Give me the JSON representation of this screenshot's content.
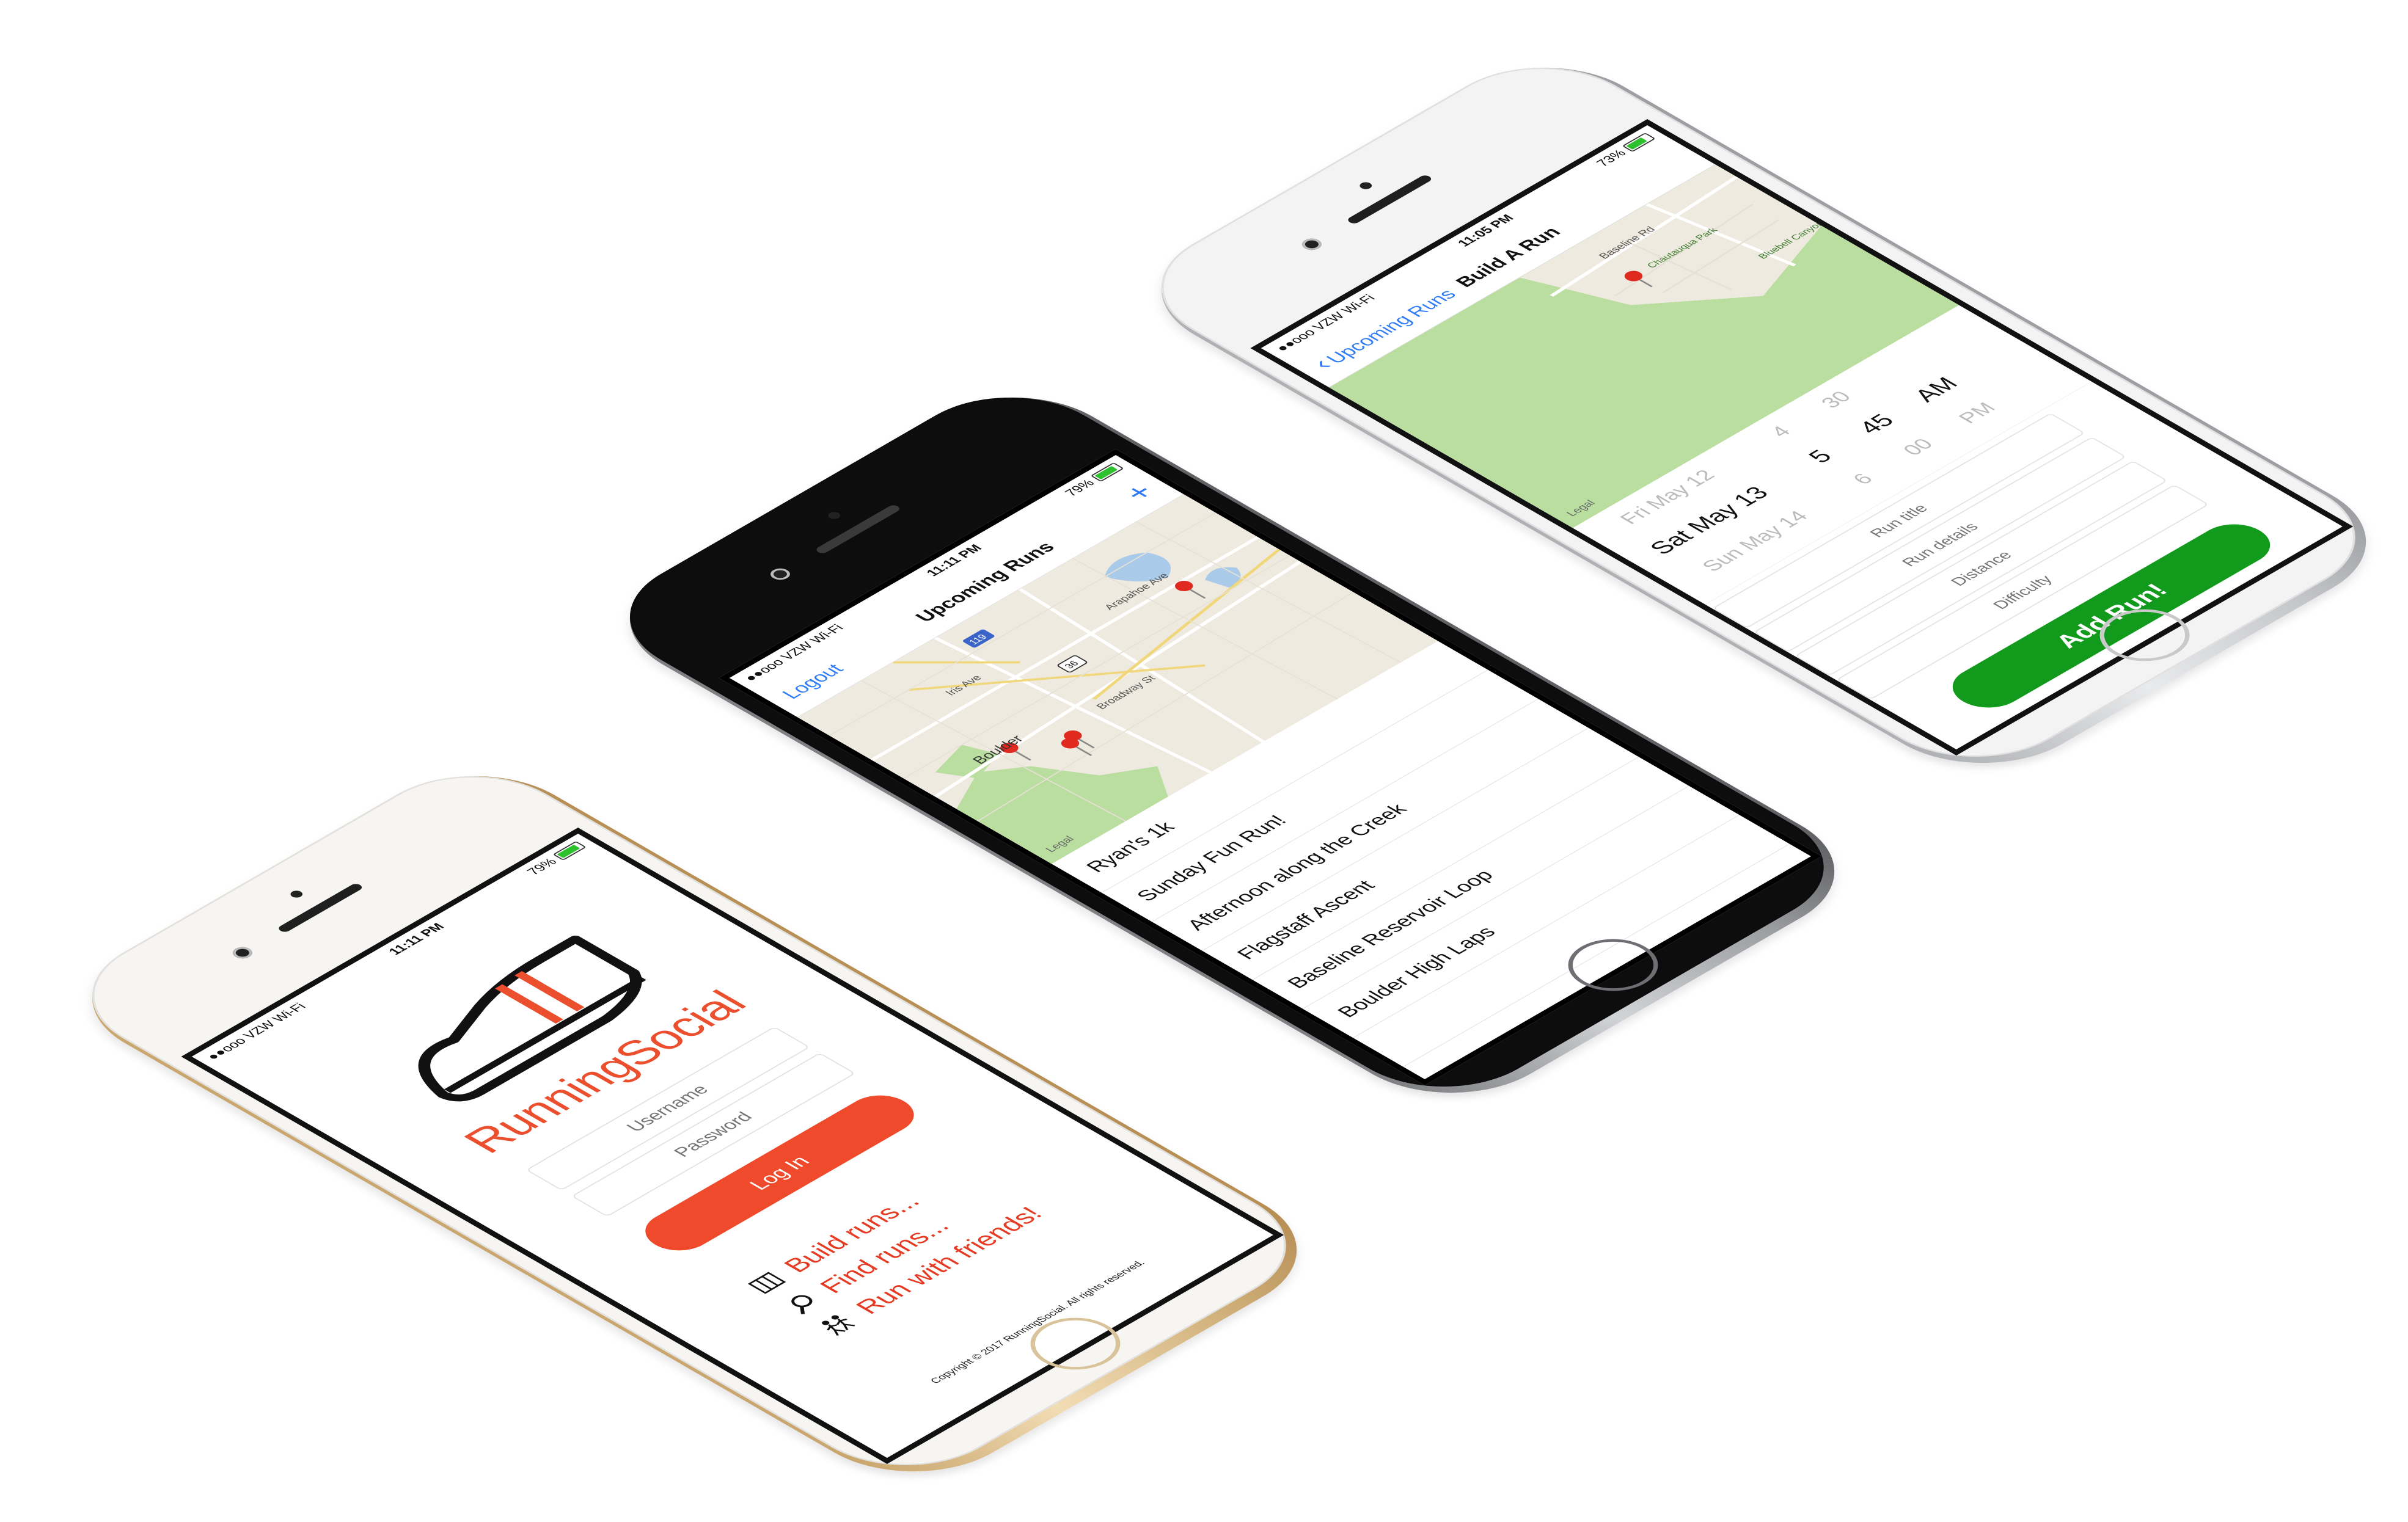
{
  "colors": {
    "brand_orange": "#ec4f2e",
    "login_button": "#f04a2c",
    "ios_blue": "#2f7cf6",
    "add_button_green": "#119a1b",
    "map_park_green": "#b9dea0"
  },
  "login_phone": {
    "status": {
      "carrier": "●●ooo VZW Wi-Fi",
      "time": "11:11 PM",
      "battery": "79%"
    },
    "app_title": "RunningSocial",
    "username_placeholder": "Username",
    "password_placeholder": "Password",
    "login_label": "Log In",
    "features": [
      {
        "icon": "map-guide-icon",
        "label": "Build runs..."
      },
      {
        "icon": "magnifier-icon",
        "label": "Find runs..."
      },
      {
        "icon": "runners-icon",
        "label": "Run with friends!"
      }
    ],
    "copyright": "Copyright © 2017 RunningSocial. All rights reserved."
  },
  "runs_phone": {
    "status": {
      "carrier": "●●ooo VZW Wi-Fi",
      "time": "11:11 PM",
      "battery": "79%"
    },
    "nav": {
      "left": "Logout",
      "title": "Upcoming Runs",
      "right": "+"
    },
    "map": {
      "labels": [
        "Boulder",
        "Broadway St",
        "Arapahoe Ave",
        "Iris Ave",
        "36",
        "119"
      ],
      "legal": "Legal"
    },
    "runs": [
      "Ryan's 1k",
      "Sunday Fun Run!",
      "Afternoon along the Creek",
      "Flagstaff Ascent",
      "Baseline Reservoir Loop",
      "Boulder High Laps"
    ]
  },
  "build_phone": {
    "status": {
      "carrier": "●●ooo VZW Wi-Fi",
      "time": "11:05 PM",
      "battery": "73%"
    },
    "nav": {
      "back": "Upcoming Runs",
      "title": "Build A Run"
    },
    "map": {
      "labels": [
        "Baseline Rd",
        "Chautauqua Park",
        "Bluebell Canyon"
      ],
      "legal": "Legal"
    },
    "picker": {
      "dates": [
        "Fri May 12",
        "Sat May 13",
        "Sun May 14"
      ],
      "hours": [
        "4",
        "5",
        "6"
      ],
      "minutes": [
        "30",
        "45",
        "00"
      ],
      "ampm": [
        "AM",
        "PM"
      ]
    },
    "placeholders": {
      "title": "Run title",
      "details": "Run details",
      "distance": "Distance",
      "difficulty": "Difficulty"
    },
    "add_label": "Add Run!"
  }
}
